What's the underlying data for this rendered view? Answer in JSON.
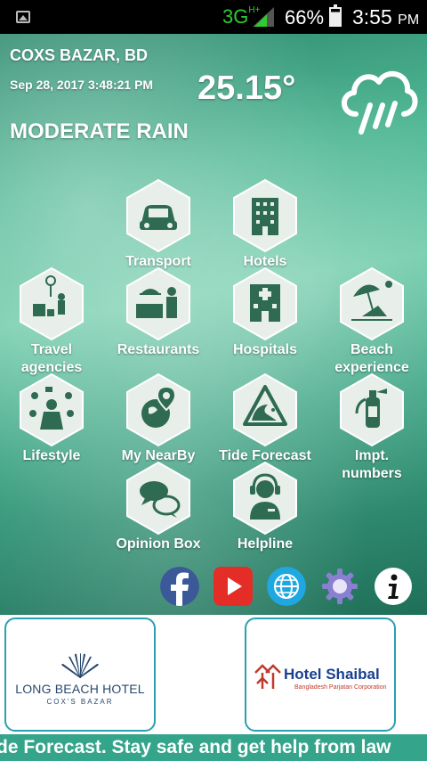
{
  "status_bar": {
    "network": "3G",
    "network_sup": "H+",
    "battery": "66%",
    "time": "3:55",
    "ampm": "PM"
  },
  "weather": {
    "city": "COXS BAZAR, BD",
    "datetime": "Sep 28, 2017 3:48:21 PM",
    "temperature": "25.15°",
    "condition": "MODERATE RAIN",
    "icon": "rain-cloud-icon"
  },
  "tiles": [
    {
      "label": "Transport",
      "icon": "car-icon"
    },
    {
      "label": "Hotels",
      "icon": "hotel-building-icon"
    },
    {
      "label": "Travel agencies",
      "icon": "traveler-luggage-icon"
    },
    {
      "label": "Restaurants",
      "icon": "waiter-dining-icon"
    },
    {
      "label": "Hospitals",
      "icon": "hospital-building-icon"
    },
    {
      "label": "Beach experience",
      "icon": "beach-umbrella-icon"
    },
    {
      "label": "Lifestyle",
      "icon": "lifestyle-person-icon"
    },
    {
      "label": "My NearBy",
      "icon": "globe-pin-icon"
    },
    {
      "label": "Tide Forecast",
      "icon": "tide-wave-warning-icon"
    },
    {
      "label": "Impt. numbers",
      "icon": "fire-extinguisher-icon"
    },
    {
      "label": "Opinion Box",
      "icon": "speech-bubbles-icon"
    },
    {
      "label": "Helpline",
      "icon": "headset-agent-icon"
    }
  ],
  "social": [
    {
      "icon": "facebook-icon",
      "color": "#3b5998"
    },
    {
      "icon": "youtube-icon",
      "color": "#e52d27"
    },
    {
      "icon": "website-globe-icon",
      "color": "#1ea7e1"
    },
    {
      "icon": "settings-gear-icon",
      "color": "#7b6fc4"
    },
    {
      "icon": "info-icon",
      "color": "#ffffff"
    }
  ],
  "ads": {
    "ad1": {
      "name": "LONG BEACH HOTEL",
      "sub": "COX'S BAZAR"
    },
    "ad2": {
      "name": "Hotel Shaibal",
      "sub": "Bangladesh Parjatan Corporation"
    }
  },
  "ticker": "de Forecast. Stay safe and get help from law",
  "colors": {
    "accent": "#2a9fb0",
    "ticker_bg": "#34a48a",
    "tile_icon": "#2e6b52"
  }
}
